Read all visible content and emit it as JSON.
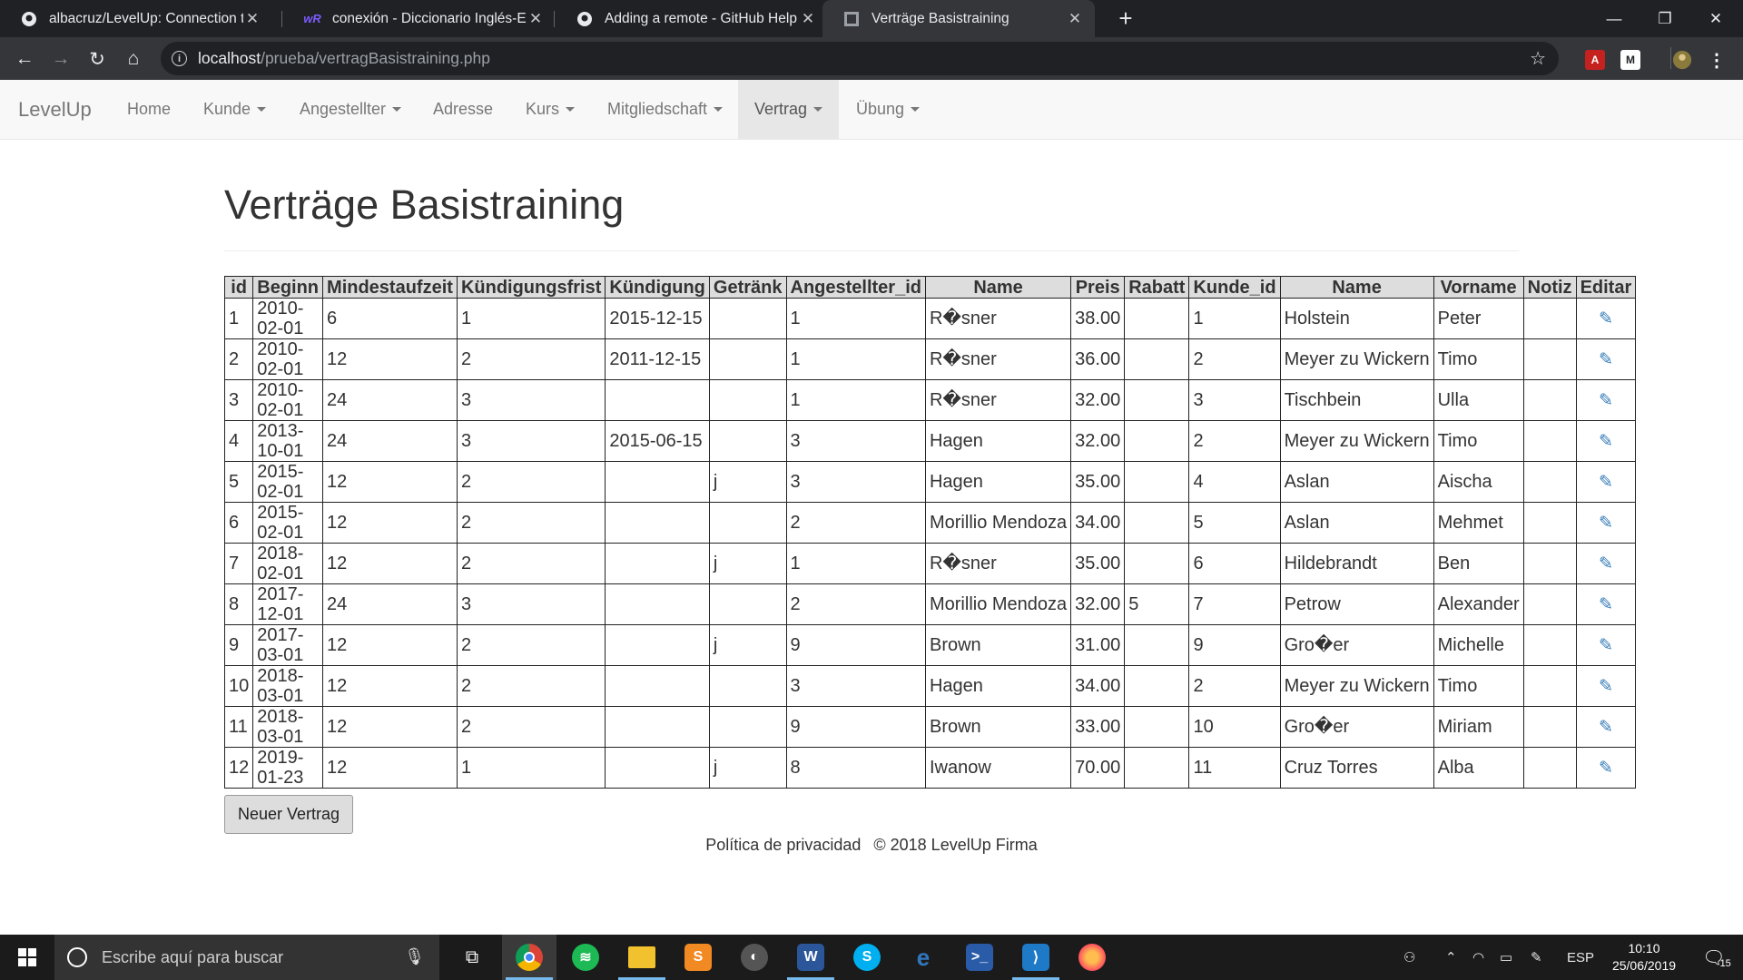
{
  "browser": {
    "tabs": [
      {
        "title": "albacruz/LevelUp: Connection to",
        "favicon": "github-icon"
      },
      {
        "title": "conexión - Diccionario Inglés-Esp",
        "favicon": "wordreference-icon"
      },
      {
        "title": "Adding a remote - GitHub Help",
        "favicon": "github-icon"
      },
      {
        "title": "Verträge Basistraining",
        "favicon": "page-icon"
      }
    ],
    "url_host": "localhost",
    "url_path": "/prueba/vertragBasistraining.php"
  },
  "navbar": {
    "brand": "LevelUp",
    "items": [
      {
        "label": "Home"
      },
      {
        "label": "Kunde"
      },
      {
        "label": "Angestellter"
      },
      {
        "label": "Adresse"
      },
      {
        "label": "Kurs"
      },
      {
        "label": "Mitgliedschaft"
      },
      {
        "label": "Vertrag"
      },
      {
        "label": "Übung"
      }
    ]
  },
  "page": {
    "title": "Verträge Basistraining",
    "new_button": "Neuer Vertrag"
  },
  "table": {
    "headers": [
      "id",
      "Beginn",
      "Mindestaufzeit",
      "Kündigungsfrist",
      "Kündigung",
      "Getränk",
      "Angestellter_id",
      "Name",
      "Preis",
      "Rabatt",
      "Kunde_id",
      "Name",
      "Vorname",
      "Notiz",
      "Editar"
    ],
    "rows": [
      [
        "1",
        "2010-02-01",
        "6",
        "1",
        "2015-12-15",
        "",
        "1",
        "R�sner",
        "38.00",
        "",
        "1",
        "Holstein",
        "Peter",
        ""
      ],
      [
        "2",
        "2010-02-01",
        "12",
        "2",
        "2011-12-15",
        "",
        "1",
        "R�sner",
        "36.00",
        "",
        "2",
        "Meyer zu Wickern",
        "Timo",
        ""
      ],
      [
        "3",
        "2010-02-01",
        "24",
        "3",
        "",
        "",
        "1",
        "R�sner",
        "32.00",
        "",
        "3",
        "Tischbein",
        "Ulla",
        ""
      ],
      [
        "4",
        "2013-10-01",
        "24",
        "3",
        "2015-06-15",
        "",
        "3",
        "Hagen",
        "32.00",
        "",
        "2",
        "Meyer zu Wickern",
        "Timo",
        ""
      ],
      [
        "5",
        "2015-02-01",
        "12",
        "2",
        "",
        "j",
        "3",
        "Hagen",
        "35.00",
        "",
        "4",
        "Aslan",
        "Aischa",
        ""
      ],
      [
        "6",
        "2015-02-01",
        "12",
        "2",
        "",
        "",
        "2",
        "Morillio Mendoza",
        "34.00",
        "",
        "5",
        "Aslan",
        "Mehmet",
        ""
      ],
      [
        "7",
        "2018-02-01",
        "12",
        "2",
        "",
        "j",
        "1",
        "R�sner",
        "35.00",
        "",
        "6",
        "Hildebrandt",
        "Ben",
        ""
      ],
      [
        "8",
        "2017-12-01",
        "24",
        "3",
        "",
        "",
        "2",
        "Morillio Mendoza",
        "32.00",
        "5",
        "7",
        "Petrow",
        "Alexander",
        ""
      ],
      [
        "9",
        "2017-03-01",
        "12",
        "2",
        "",
        "j",
        "9",
        "Brown",
        "31.00",
        "",
        "9",
        "Gro�er",
        "Michelle",
        ""
      ],
      [
        "10",
        "2018-03-01",
        "12",
        "2",
        "",
        "",
        "3",
        "Hagen",
        "34.00",
        "",
        "2",
        "Meyer zu Wickern",
        "Timo",
        ""
      ],
      [
        "11",
        "2018-03-01",
        "12",
        "2",
        "",
        "",
        "9",
        "Brown",
        "33.00",
        "",
        "10",
        "Gro�er",
        "Miriam",
        ""
      ],
      [
        "12",
        "2019-01-23",
        "12",
        "1",
        "",
        "j",
        "8",
        "Iwanow",
        "70.00",
        "",
        "11",
        "Cruz Torres",
        "Alba",
        ""
      ]
    ],
    "edit_icon": "edit-icon"
  },
  "footer": {
    "privacy": "Política de privacidad",
    "copyright": "© 2018 LevelUp Firma"
  },
  "taskbar": {
    "search_placeholder": "Escribe aquí para buscar",
    "language": "ESP",
    "time": "10:10",
    "date": "25/06/2019",
    "notification_count": "15"
  }
}
